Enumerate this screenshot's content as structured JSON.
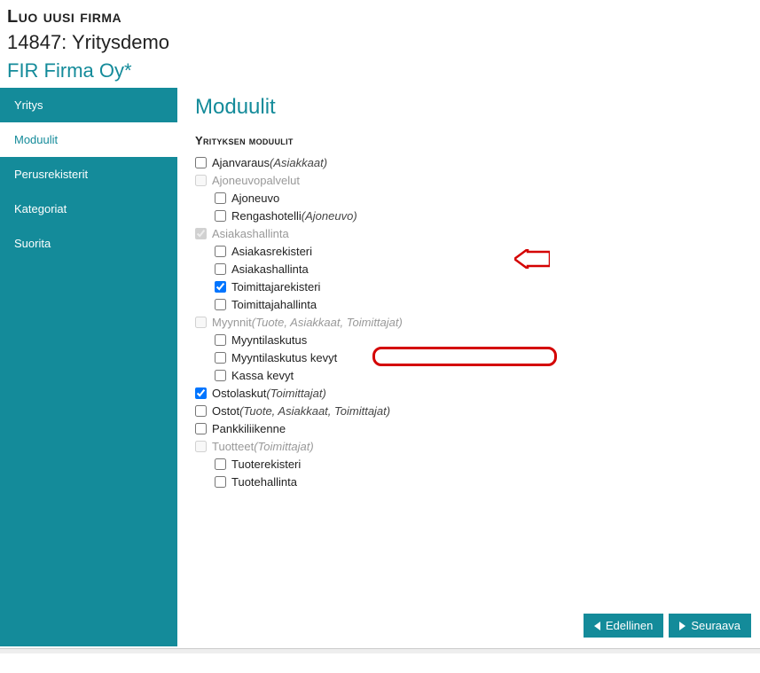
{
  "header": {
    "title": "Luo uusi firma",
    "subId": "14847: Yritysdemo",
    "company": "FIR Firma Oy*"
  },
  "sidebar": {
    "items": [
      {
        "label": "Yritys",
        "active": false
      },
      {
        "label": "Moduulit",
        "active": true
      },
      {
        "label": "Perusrekisterit",
        "active": false
      },
      {
        "label": "Kategoriat",
        "active": false
      },
      {
        "label": "Suorita",
        "active": false
      }
    ]
  },
  "content": {
    "title": "Moduulit",
    "sectionLabel": "Yrityksen moduulit"
  },
  "modules": [
    {
      "id": "ajanvaraus",
      "label": "Ajanvaraus",
      "dep": "(Asiakkaat)",
      "checked": false,
      "disabled": false,
      "indent": 0
    },
    {
      "id": "ajoneuvopalvelut",
      "label": "Ajoneuvopalvelut",
      "dep": "",
      "checked": false,
      "disabled": true,
      "indent": 0
    },
    {
      "id": "ajoneuvo",
      "label": "Ajoneuvo",
      "dep": "",
      "checked": false,
      "disabled": false,
      "indent": 1
    },
    {
      "id": "rengashotelli",
      "label": "Rengashotelli",
      "dep": "(Ajoneuvo)",
      "checked": false,
      "disabled": false,
      "indent": 1
    },
    {
      "id": "asiakashallinta-top",
      "label": "Asiakashallinta",
      "dep": "",
      "checked": true,
      "disabled": true,
      "indent": 0
    },
    {
      "id": "asiakasrekisteri",
      "label": "Asiakasrekisteri",
      "dep": "",
      "checked": false,
      "disabled": false,
      "indent": 1
    },
    {
      "id": "asiakashallinta",
      "label": "Asiakashallinta",
      "dep": "",
      "checked": false,
      "disabled": false,
      "indent": 1
    },
    {
      "id": "toimittajarekisteri",
      "label": "Toimittajarekisteri",
      "dep": "",
      "checked": true,
      "disabled": false,
      "indent": 1
    },
    {
      "id": "toimittajahallinta",
      "label": "Toimittajahallinta",
      "dep": "",
      "checked": false,
      "disabled": false,
      "indent": 1
    },
    {
      "id": "myynnit",
      "label": "Myynnit",
      "dep": "(Tuote, Asiakkaat, Toimittajat)",
      "checked": false,
      "disabled": true,
      "indent": 0
    },
    {
      "id": "myyntilaskutus",
      "label": "Myyntilaskutus",
      "dep": "",
      "checked": false,
      "disabled": false,
      "indent": 1
    },
    {
      "id": "myyntilaskutus-kevyt",
      "label": "Myyntilaskutus kevyt",
      "dep": "",
      "checked": false,
      "disabled": false,
      "indent": 1
    },
    {
      "id": "kassa-kevyt",
      "label": "Kassa kevyt",
      "dep": "",
      "checked": false,
      "disabled": false,
      "indent": 1
    },
    {
      "id": "ostolaskut",
      "label": "Ostolaskut",
      "dep": "(Toimittajat)",
      "checked": true,
      "disabled": false,
      "indent": 0
    },
    {
      "id": "ostot",
      "label": "Ostot",
      "dep": "(Tuote, Asiakkaat, Toimittajat)",
      "checked": false,
      "disabled": false,
      "indent": 0
    },
    {
      "id": "pankkiliikenne",
      "label": "Pankkiliikenne",
      "dep": "",
      "checked": false,
      "disabled": false,
      "indent": 0
    },
    {
      "id": "tuotteet",
      "label": "Tuotteet",
      "dep": "(Toimittajat)",
      "checked": false,
      "disabled": true,
      "indent": 0
    },
    {
      "id": "tuoterekisteri",
      "label": "Tuoterekisteri",
      "dep": "",
      "checked": false,
      "disabled": false,
      "indent": 1
    },
    {
      "id": "tuotehallinta",
      "label": "Tuotehallinta",
      "dep": "",
      "checked": false,
      "disabled": false,
      "indent": 1
    }
  ],
  "buttons": {
    "prev": "Edellinen",
    "next": "Seuraava"
  }
}
